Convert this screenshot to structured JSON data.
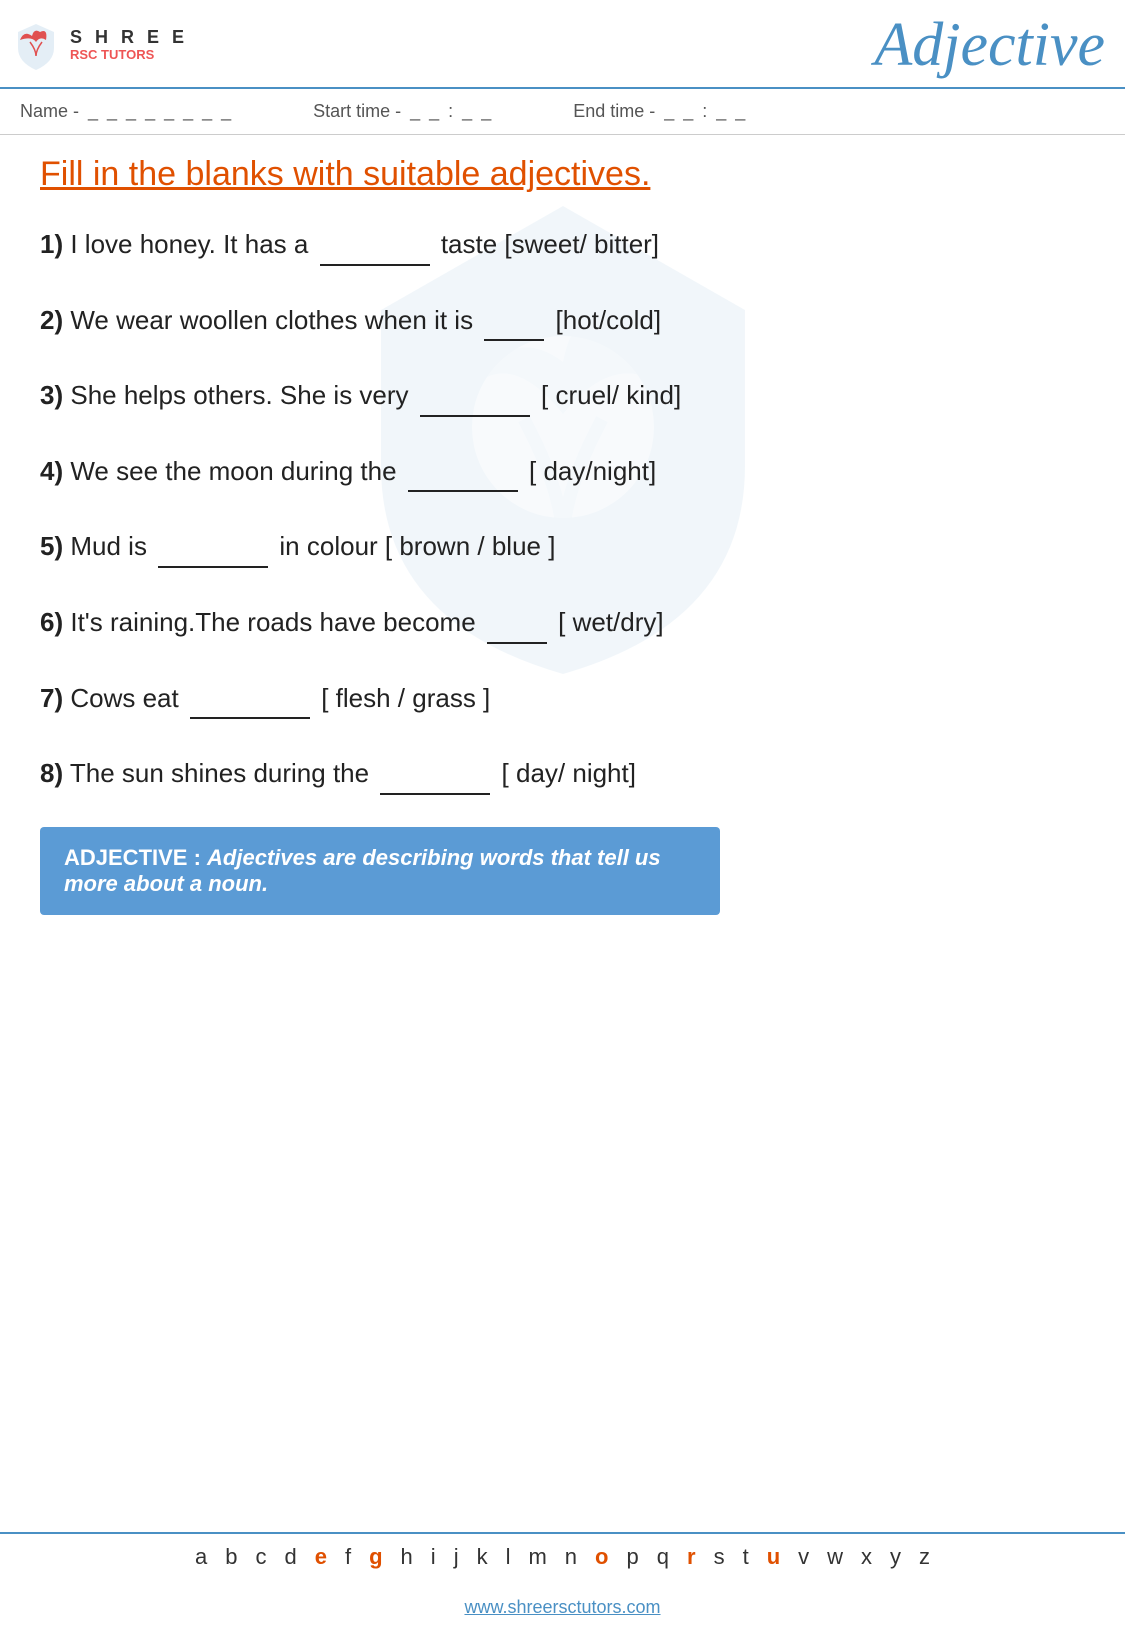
{
  "header": {
    "logo_shree": "S H R E E",
    "logo_rsc": "RSC TUTORS",
    "title": "Adjective"
  },
  "info_row": {
    "name_label": "Name -",
    "name_blanks": "_ _ _ _ _ _ _ _",
    "start_label": "Start time -",
    "start_blanks": "_ _ : _ _",
    "end_label": "End time -",
    "end_blanks": "_ _ : _ _"
  },
  "section_title": "Fill in the blanks with suitable adjectives.",
  "questions": [
    {
      "num": "1)",
      "text_before": "I love honey. It has a",
      "blank_size": "medium",
      "text_after": "taste [sweet/ bitter]"
    },
    {
      "num": "2)",
      "text_before": "We wear woollen clothes when it is",
      "blank_size": "small",
      "text_after": "[hot/cold]"
    },
    {
      "num": "3)",
      "text_before": "She helps others. She is very",
      "blank_size": "medium",
      "text_after": "[ cruel/ kind]"
    },
    {
      "num": "4)",
      "text_before": "We see the moon during the",
      "blank_size": "large",
      "text_after": "[ day/night]"
    },
    {
      "num": "5)",
      "text_before": "Mud is",
      "blank_size": "medium",
      "text_after": "in colour [ brown / blue ]"
    },
    {
      "num": "6)",
      "text_before": "It's raining.The roads have become",
      "blank_size": "small",
      "text_after": "[ wet/dry]"
    },
    {
      "num": "7)",
      "text_before": "Cows eat",
      "blank_size": "large",
      "text_after": "[ flesh / grass ]"
    },
    {
      "num": "8)",
      "text_before": "The sun shines during the",
      "blank_size": "medium",
      "text_after": "[ day/ night]"
    }
  ],
  "definition": {
    "label": "ADJECTIVE : ",
    "text": "Adjectives are describing words that tell us more about a noun."
  },
  "alphabet": [
    "a",
    "b",
    "c",
    "d",
    "e",
    "f",
    "g",
    "h",
    "i",
    "j",
    "k",
    "l",
    "m",
    "n",
    "o",
    "p",
    "q",
    "r",
    "s",
    "t",
    "u",
    "v",
    "w",
    "x",
    "y",
    "z"
  ],
  "footer_url": "www.shreersctutors.com"
}
